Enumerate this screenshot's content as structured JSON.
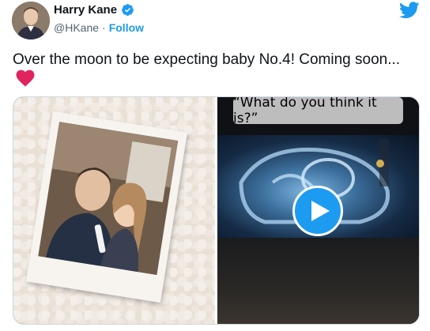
{
  "author": {
    "name": "Harry Kane",
    "handle": "@HKane",
    "separator": "·",
    "follow_label": "Follow",
    "verified": true
  },
  "tweet": {
    "text": "Over the moon to be expecting baby No.4! Coming soon..."
  },
  "media": {
    "video_caption": "“What do you think it is?”",
    "play_icon": "play-icon"
  },
  "icons": {
    "brand": "twitter-bird-icon",
    "verified": "verified-badge-icon",
    "heart": "red-heart-icon"
  },
  "colors": {
    "accent": "#1d9bf0",
    "heart": "#e0245e",
    "text": "#0f1419",
    "secondary_text": "#536471"
  }
}
